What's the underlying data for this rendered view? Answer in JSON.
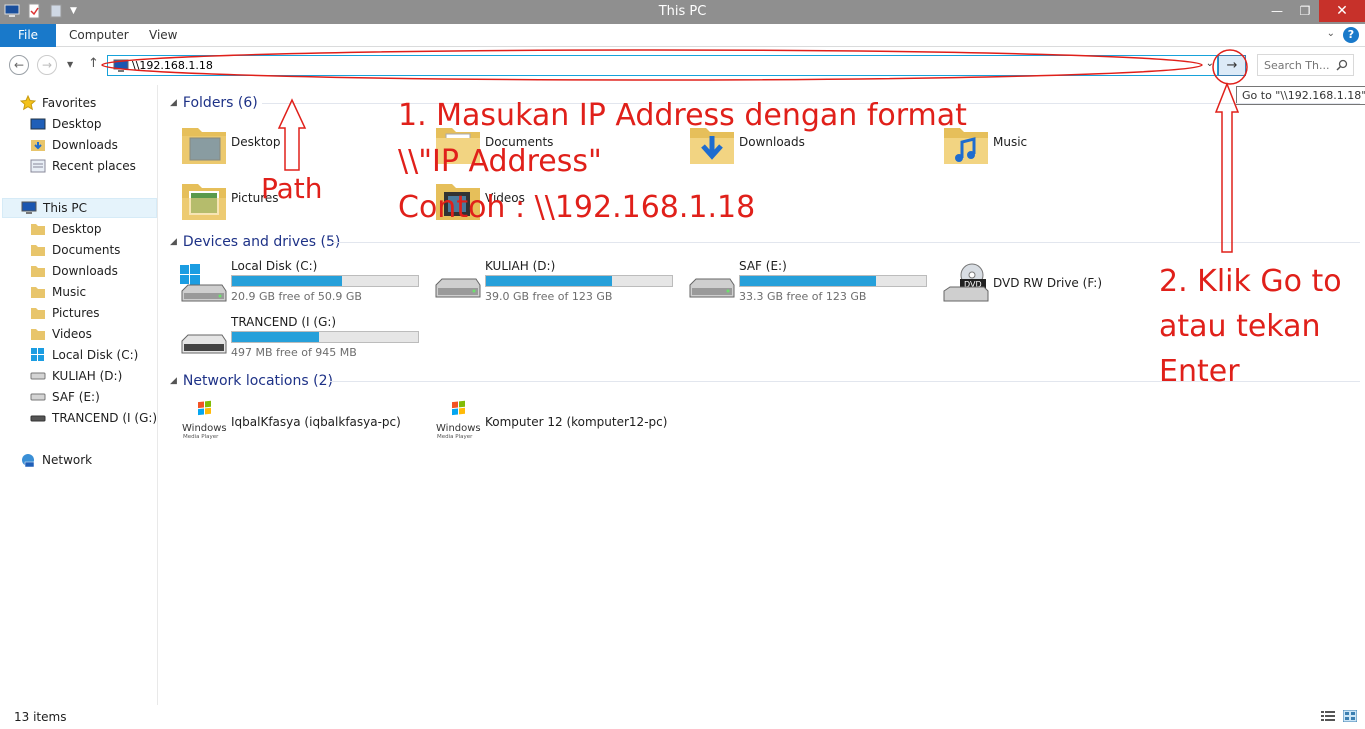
{
  "window": {
    "title": "This PC"
  },
  "ribbon": {
    "tabs": [
      "File",
      "Computer",
      "View"
    ],
    "help": "?"
  },
  "nav": {
    "address_value": "\\\\192.168.1.18",
    "search_placeholder": "Search Th...",
    "go_tooltip": "Go to \"\\\\192.168.1.18\""
  },
  "sidebar": {
    "favorites": {
      "label": "Favorites",
      "items": [
        "Desktop",
        "Downloads",
        "Recent places"
      ]
    },
    "this_pc": {
      "label": "This PC",
      "items": [
        "Desktop",
        "Documents",
        "Downloads",
        "Music",
        "Pictures",
        "Videos",
        "Local Disk (C:)",
        "KULIAH (D:)",
        "SAF (E:)",
        "TRANCEND (I (G:)"
      ]
    },
    "network": {
      "label": "Network"
    }
  },
  "main": {
    "folders": {
      "header": "Folders (6)",
      "items": [
        "Desktop",
        "Documents",
        "Downloads",
        "Music",
        "Pictures",
        "Videos"
      ]
    },
    "devices": {
      "header": "Devices and drives (5)",
      "items": [
        {
          "name": "Local Disk (C:)",
          "free": "20.9 GB free of 50.9 GB",
          "used_fraction": 0.59
        },
        {
          "name": "KULIAH (D:)",
          "free": "39.0 GB free of 123 GB",
          "used_fraction": 0.68
        },
        {
          "name": "SAF (E:)",
          "free": "33.3 GB free of 123 GB",
          "used_fraction": 0.73
        },
        {
          "name": "DVD RW Drive (F:)"
        },
        {
          "name": "TRANCEND (I (G:)",
          "free": "497 MB free of 945 MB",
          "used_fraction": 0.47
        }
      ]
    },
    "network": {
      "header": "Network locations (2)",
      "items": [
        "IqbalKfasya (iqbalkfasya-pc)",
        "Komputer 12 (komputer12-pc)"
      ],
      "logo_text": [
        "Windows",
        "Media Player"
      ]
    }
  },
  "status": {
    "items_count": "13 items"
  },
  "annotations": {
    "step1": [
      "1. Masukan IP Address dengan format",
      "\\\\\"IP Address\"",
      "Contoh : \\\\192.168.1.18"
    ],
    "path": "Path",
    "step2": [
      "2. Klik Go to",
      "atau tekan",
      "Enter"
    ]
  },
  "colors": {
    "accent": "#1979ca",
    "annotation": "#e0201a",
    "bar_fill": "#26a0da",
    "titlebar": "#8f8f8f"
  }
}
